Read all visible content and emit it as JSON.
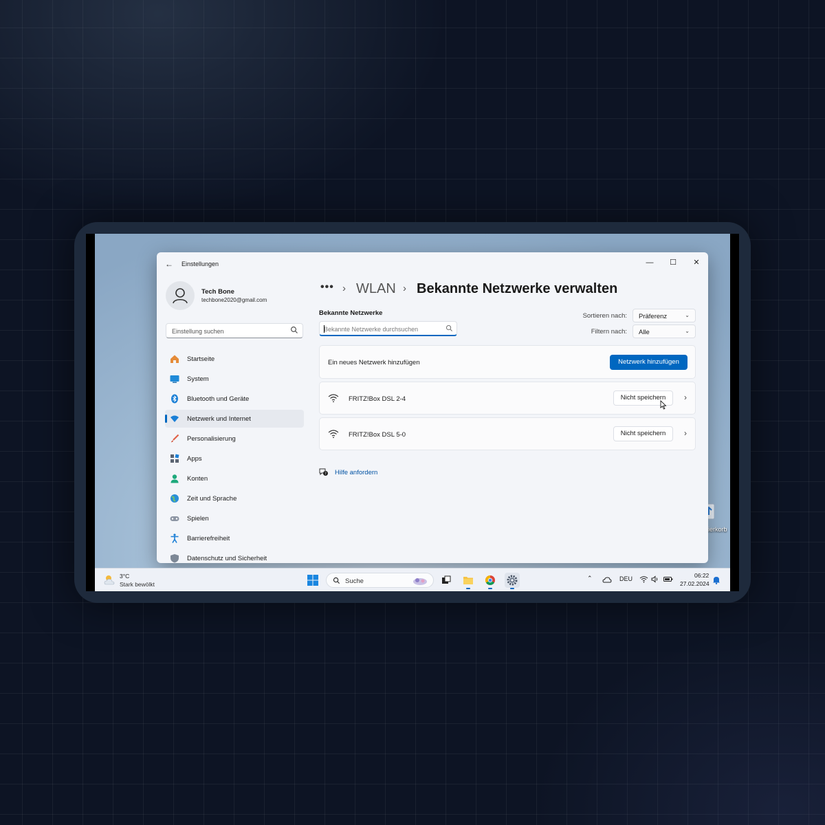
{
  "window": {
    "title": "Einstellungen",
    "controls": {
      "minimize": "—",
      "maximize": "☐",
      "close": "✕"
    }
  },
  "profile": {
    "name": "Tech Bone",
    "email": "techbone2020@gmail.com"
  },
  "sidebar": {
    "search_placeholder": "Einstellung suchen",
    "items": [
      {
        "label": "Startseite",
        "icon": "home-icon"
      },
      {
        "label": "System",
        "icon": "system-icon"
      },
      {
        "label": "Bluetooth und Geräte",
        "icon": "bluetooth-icon"
      },
      {
        "label": "Netzwerk und Internet",
        "icon": "network-icon",
        "active": true
      },
      {
        "label": "Personalisierung",
        "icon": "brush-icon"
      },
      {
        "label": "Apps",
        "icon": "apps-icon"
      },
      {
        "label": "Konten",
        "icon": "account-icon"
      },
      {
        "label": "Zeit und Sprache",
        "icon": "globe-icon"
      },
      {
        "label": "Spielen",
        "icon": "gamepad-icon"
      },
      {
        "label": "Barrierefreiheit",
        "icon": "accessibility-icon"
      },
      {
        "label": "Datenschutz und Sicherheit",
        "icon": "shield-icon"
      }
    ]
  },
  "breadcrumb": {
    "more": "•••",
    "sep": "›",
    "parent": "WLAN",
    "current": "Bekannte Netzwerke verwalten"
  },
  "known": {
    "label": "Bekannte Netzwerke",
    "search_placeholder": "Bekannte Netzwerke durchsuchen",
    "sort_label": "Sortieren nach:",
    "sort_value": "Präferenz",
    "filter_label": "Filtern nach:",
    "filter_value": "Alle"
  },
  "add_network": {
    "text": "Ein neues Netzwerk hinzufügen",
    "button": "Netzwerk hinzufügen"
  },
  "networks": [
    {
      "name": "FRITZ!Box DSL 2-4",
      "forget": "Nicht speichern"
    },
    {
      "name": "FRITZ!Box DSL 5-0",
      "forget": "Nicht speichern"
    }
  ],
  "help": {
    "label": "Hilfe anfordern"
  },
  "desktop_icon": {
    "label": "Papierkorb"
  },
  "taskbar": {
    "weather_temp": "3°C",
    "weather_condition": "Stark bewölkt",
    "search_label": "Suche",
    "language": "DEU",
    "time": "06:22",
    "date": "27.02.2024"
  },
  "colors": {
    "accent": "#0067c0",
    "link": "#0052a3",
    "window_bg": "#f3f5f9"
  }
}
